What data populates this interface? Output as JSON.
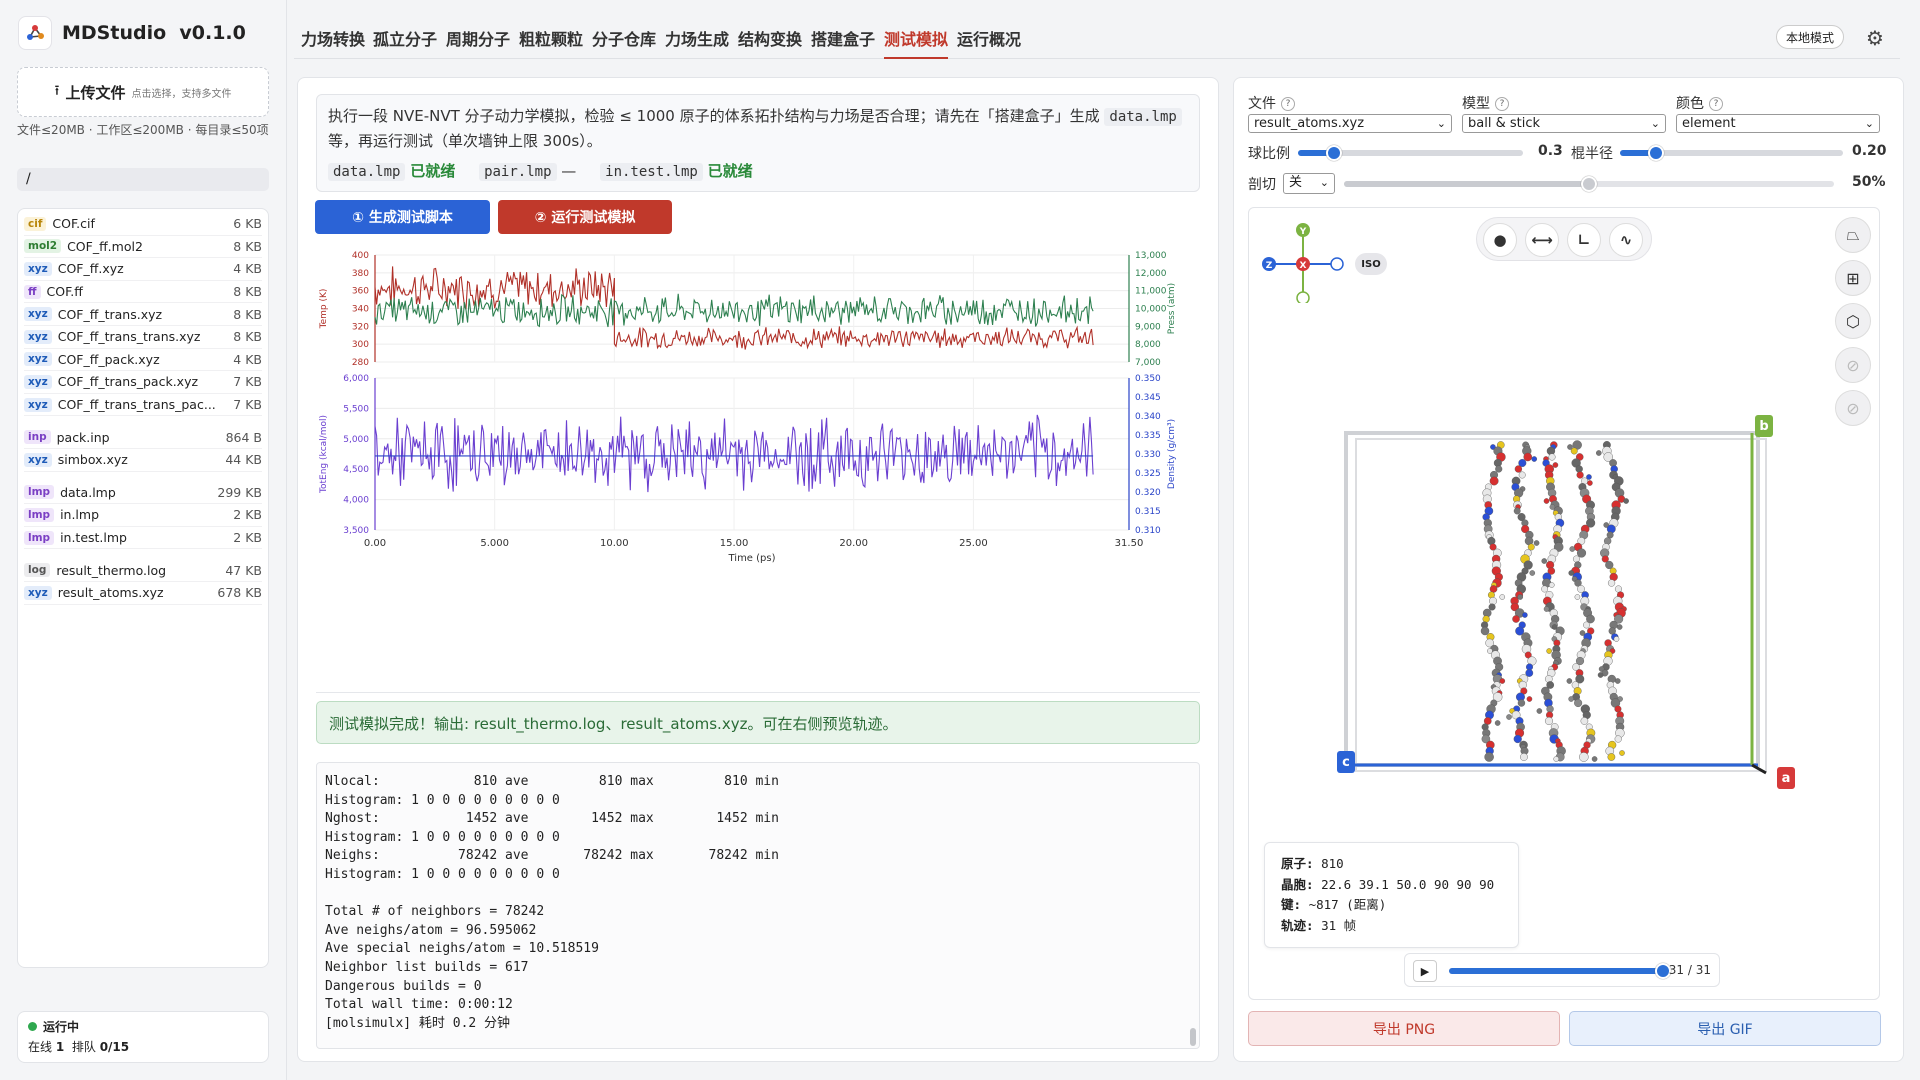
{
  "app": {
    "name": "MDStudio",
    "version": "v0.1.0"
  },
  "upload": {
    "label": "上传文件",
    "hint": "点击选择，支持多文件"
  },
  "limits": "文件≤20MB · 工作区≤200MB · 每目录≤50项",
  "path": "/",
  "files": [
    {
      "badge": "cif",
      "name": "COF.cif",
      "size": "6 KB",
      "color": "#b8860b",
      "bg": "#fbf2d8"
    },
    {
      "badge": "mol2",
      "name": "COF_ff.mol2",
      "size": "8 KB",
      "color": "#2e7d32",
      "bg": "#e3f3e4"
    },
    {
      "badge": "xyz",
      "name": "COF_ff.xyz",
      "size": "4 KB",
      "color": "#1e5bb8",
      "bg": "#e3ecfa"
    },
    {
      "badge": "ff",
      "name": "COF.ff",
      "size": "8 KB",
      "color": "#7b3fc4",
      "bg": "#efe5fa"
    },
    {
      "badge": "xyz",
      "name": "COF_ff_trans.xyz",
      "size": "8 KB",
      "color": "#1e5bb8",
      "bg": "#e3ecfa"
    },
    {
      "badge": "xyz",
      "name": "COF_ff_trans_trans.xyz",
      "size": "8 KB",
      "color": "#1e5bb8",
      "bg": "#e3ecfa"
    },
    {
      "badge": "xyz",
      "name": "COF_ff_pack.xyz",
      "size": "4 KB",
      "color": "#1e5bb8",
      "bg": "#e3ecfa"
    },
    {
      "badge": "xyz",
      "name": "COF_ff_trans_pack.xyz",
      "size": "7 KB",
      "color": "#1e5bb8",
      "bg": "#e3ecfa"
    },
    {
      "badge": "xyz",
      "name": "COF_ff_trans_trans_pac...",
      "size": "7 KB",
      "color": "#1e5bb8",
      "bg": "#e3ecfa",
      "gap": true
    },
    {
      "badge": "inp",
      "name": "pack.inp",
      "size": "864 B",
      "color": "#7b3fc4",
      "bg": "#efe5fa"
    },
    {
      "badge": "xyz",
      "name": "simbox.xyz",
      "size": "44 KB",
      "color": "#1e5bb8",
      "bg": "#e3ecfa",
      "gap": true
    },
    {
      "badge": "lmp",
      "name": "data.lmp",
      "size": "299 KB",
      "color": "#7b3fc4",
      "bg": "#efe5fa"
    },
    {
      "badge": "lmp",
      "name": "in.lmp",
      "size": "2 KB",
      "color": "#7b3fc4",
      "bg": "#efe5fa"
    },
    {
      "badge": "lmp",
      "name": "in.test.lmp",
      "size": "2 KB",
      "color": "#7b3fc4",
      "bg": "#efe5fa",
      "gap": true
    },
    {
      "badge": "log",
      "name": "result_thermo.log",
      "size": "47 KB",
      "color": "#555555",
      "bg": "#ececee"
    },
    {
      "badge": "xyz",
      "name": "result_atoms.xyz",
      "size": "678 KB",
      "color": "#1e5bb8",
      "bg": "#e3ecfa"
    }
  ],
  "status": {
    "state": "运行中",
    "online_label": "在线",
    "online": "1",
    "queue_label": "排队",
    "queue": "0/15"
  },
  "tabs": [
    "力场转换",
    "孤立分子",
    "周期分子",
    "粗粒颗粒",
    "分子仓库",
    "力场生成",
    "结构变换",
    "搭建盒子",
    "测试模拟",
    "运行概况"
  ],
  "active_tab": 8,
  "local_mode": "本地模式",
  "desc": {
    "text1": "执行一段 NVE-NVT 分子动力学模拟，检验 ≤ 1000 原子的体系拓扑结构与力场是否合理；请先在「搭建盒子」生成",
    "code1": "data.lmp",
    "text2": "等，再运行测试（单次墙钟上限 300s）。",
    "files": [
      {
        "name": "data.lmp",
        "state": "已就绪"
      },
      {
        "name": "pair.lmp",
        "state": "—"
      },
      {
        "name": "in.test.lmp",
        "state": "已就绪"
      }
    ]
  },
  "buttons": {
    "gen": "① 生成测试脚本",
    "run": "② 运行测试模拟"
  },
  "chart_data": [
    {
      "type": "line",
      "xlabel": "Time (ps)",
      "xlim": [
        0,
        31.5
      ],
      "xticks": [
        "0.00",
        "5.000",
        "10.00",
        "15.00",
        "20.00",
        "25.00",
        "31.50"
      ],
      "ylabel": "Temp (K)",
      "ylim": [
        280,
        400
      ],
      "yticks": [
        "280",
        "300",
        "320",
        "340",
        "360",
        "380",
        "400"
      ],
      "y2label": "Press (atm)",
      "y2lim": [
        7000,
        13000
      ],
      "y2ticks": [
        "7,000",
        "8,000",
        "9,000",
        "10,000",
        "11,000",
        "12,000",
        "13,000"
      ],
      "series": [
        {
          "name": "Temp (K)",
          "axis": "left",
          "color": "#b03028",
          "segments": [
            {
              "x0": 0,
              "x1": 10,
              "mean": 363,
              "amp": 18
            },
            {
              "x0": 10,
              "x1": 30,
              "mean": 307,
              "amp": 9
            }
          ]
        },
        {
          "name": "Press (atm)",
          "axis": "right",
          "color": "#2e8050",
          "segments": [
            {
              "x0": 0,
              "x1": 30,
              "mean": 9900,
              "amp": 650
            }
          ]
        }
      ]
    },
    {
      "type": "line",
      "xlabel": "Time (ps)",
      "xlim": [
        0,
        31.5
      ],
      "ylabel": "TotEng (kcal/mol)",
      "ylim": [
        3500,
        6000
      ],
      "yticks": [
        "3,500",
        "4,000",
        "4,500",
        "5,000",
        "5,500",
        "6,000"
      ],
      "y2label": "Density (g/cm³)",
      "y2lim": [
        0.31,
        0.35
      ],
      "y2ticks": [
        "0.310",
        "0.315",
        "0.320",
        "0.325",
        "0.330",
        "0.335",
        "0.340",
        "0.345",
        "0.350"
      ],
      "series": [
        {
          "name": "TotEng (kcal/mol)",
          "axis": "left",
          "color": "#6a3fd0",
          "segments": [
            {
              "x0": 0,
              "x1": 30,
              "mean": 4750,
              "amp": 450
            }
          ]
        },
        {
          "name": "Density (g/cm³)",
          "axis": "right",
          "color": "#2a44c8",
          "constant": 0.3295
        }
      ]
    }
  ],
  "done_msg": "测试模拟完成！输出: result_thermo.log、result_atoms.xyz。可在右侧预览轨迹。",
  "log_lines": [
    "Nlocal:            810 ave         810 max         810 min",
    "Histogram: 1 0 0 0 0 0 0 0 0 0",
    "Nghost:           1452 ave        1452 max        1452 min",
    "Histogram: 1 0 0 0 0 0 0 0 0 0",
    "Neighs:          78242 ave       78242 max       78242 min",
    "Histogram: 1 0 0 0 0 0 0 0 0 0",
    "",
    "Total # of neighbors = 78242",
    "Ave neighs/atom = 96.595062",
    "Ave special neighs/atom = 10.518519",
    "Neighbor list builds = 617",
    "Dangerous builds = 0",
    "Total wall time: 0:00:12",
    "[molsimulx] 耗时 0.2 分钟"
  ],
  "viewer": {
    "file_label": "文件",
    "file_value": "result_atoms.xyz",
    "model_label": "模型",
    "model_value": "ball & stick",
    "color_label": "颜色",
    "color_value": "element",
    "ball_label": "球比例",
    "ball_value": "0.3",
    "ball_frac": 0.16,
    "stick_label": "棍半径",
    "stick_value": "0.20",
    "stick_frac": 0.16,
    "clip_label": "剖切",
    "clip_select": "关",
    "clip_value": "50%",
    "clip_frac": 0.5,
    "axis": {
      "y": "Y",
      "z": "Z",
      "x": "X"
    },
    "iso": "ISO",
    "box_labels": {
      "a": "a",
      "b": "b",
      "c": "c"
    },
    "info": {
      "atoms_label": "原子:",
      "atoms": "810",
      "cell_label": "晶胞:",
      "cell": "22.6 39.1 50.0 90 90 90",
      "bonds_label": "键:",
      "bonds": "~817 (距离)",
      "traj_label": "轨迹:",
      "traj": "31 帧"
    },
    "frame": "31 / 31",
    "frame_frac": 1.0,
    "export_png": "导出 PNG",
    "export_gif": "导出 GIF"
  }
}
